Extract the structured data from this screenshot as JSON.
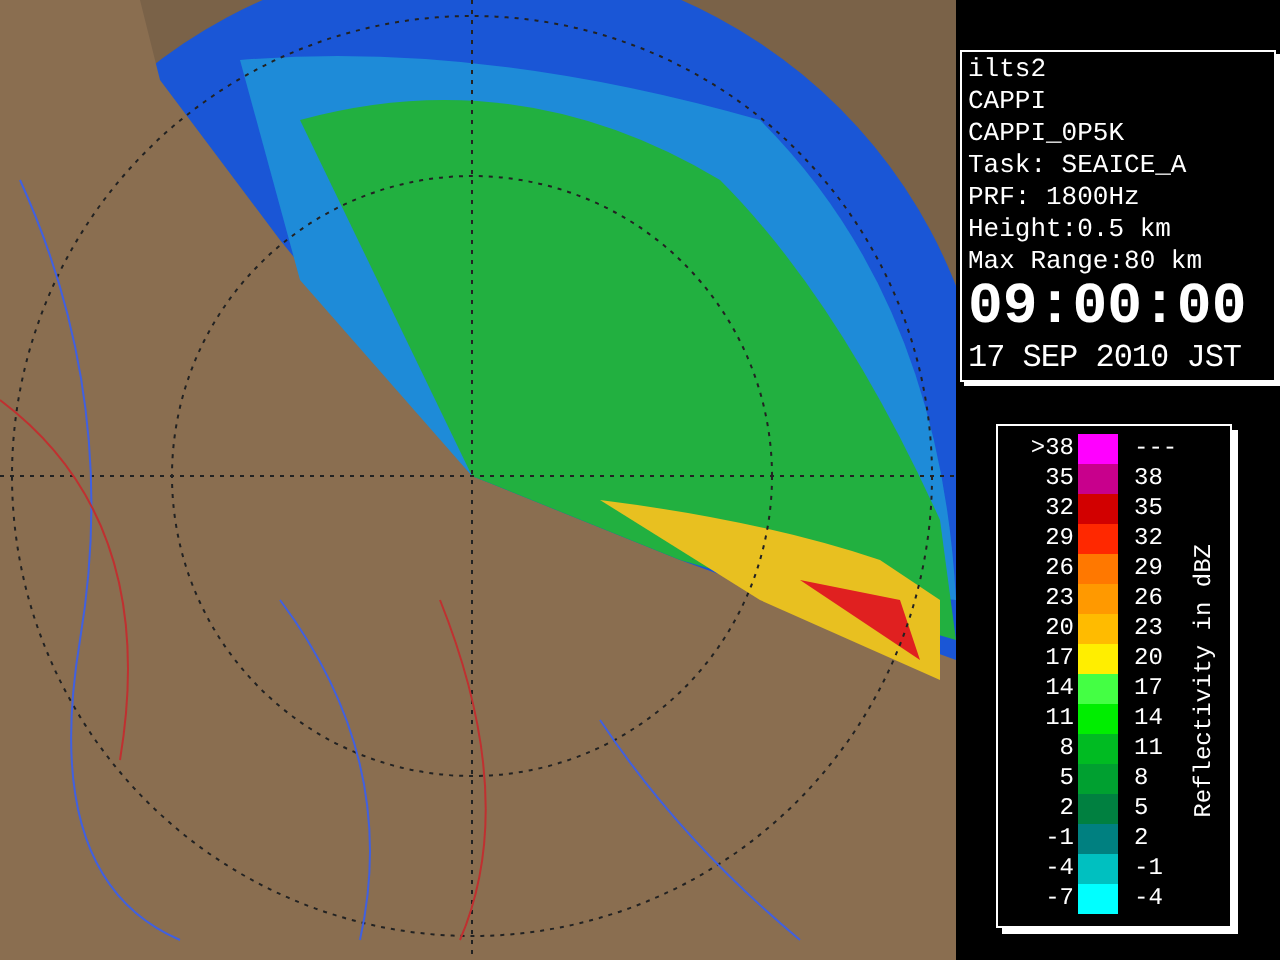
{
  "info_panel": {
    "lines": [
      "ilts2",
      "CAPPI",
      "CAPPI_0P5K",
      "Task: SEAICE_A",
      "PRF: 1800Hz",
      "Height:0.5 km",
      "Max Range:80 km"
    ],
    "time": "09:00:00",
    "date": "17 SEP 2010 JST"
  },
  "legend": {
    "title": "Reflectivity in dBZ",
    "rows": [
      {
        "low": ">38",
        "high": "---",
        "color": "#ff00ff"
      },
      {
        "low": "35",
        "high": "38",
        "color": "#c8008c"
      },
      {
        "low": "32",
        "high": "35",
        "color": "#d20000"
      },
      {
        "low": "29",
        "high": "32",
        "color": "#ff2800"
      },
      {
        "low": "26",
        "high": "29",
        "color": "#ff7800"
      },
      {
        "low": "23",
        "high": "26",
        "color": "#ff9900"
      },
      {
        "low": "20",
        "high": "23",
        "color": "#ffbb00"
      },
      {
        "low": "17",
        "high": "20",
        "color": "#ffee00"
      },
      {
        "low": "14",
        "high": "17",
        "color": "#44ff44"
      },
      {
        "low": "11",
        "high": "14",
        "color": "#00ee00"
      },
      {
        "low": "8",
        "high": "11",
        "color": "#00bb22"
      },
      {
        "low": "5",
        "high": "8",
        "color": "#00a030"
      },
      {
        "low": "2",
        "high": "5",
        "color": "#008040"
      },
      {
        "low": "-1",
        "high": "2",
        "color": "#008080"
      },
      {
        "low": "-4",
        "high": "-1",
        "color": "#00c0c0"
      },
      {
        "low": "-7",
        "high": "-4",
        "color": "#00ffff"
      }
    ]
  }
}
